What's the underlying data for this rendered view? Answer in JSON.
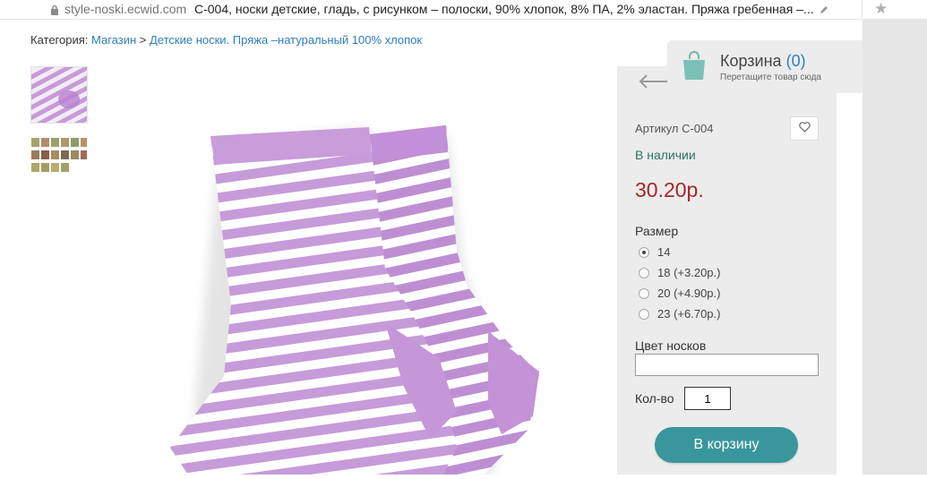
{
  "browser": {
    "domain": "style-noski.ecwid.com",
    "tab_title": "С-004, носки детские, гладь, с рисунком – полоски, 90% хлопок, 8% ПА, 2% эластан. Пряжа гребенная –...",
    "icons": [
      "lock-icon",
      "pencil-icon",
      "star-icon"
    ]
  },
  "breadcrumb": {
    "prefix": "Категория:",
    "items": [
      "Магазин",
      "Детские носки. Пряжа –натуральный 100% хлопок"
    ],
    "separator": " > "
  },
  "cart": {
    "title": "Корзина",
    "count": "(0)",
    "hint": "Перетащите товар сюда"
  },
  "product": {
    "sku": "Артикул С-004",
    "stock": "В наличии",
    "price": "30.20р.",
    "size_label": "Размер",
    "sizes": [
      {
        "label": "14",
        "selected": true
      },
      {
        "label": "18 (+3.20р.)",
        "selected": false
      },
      {
        "label": "20 (+4.90р.)",
        "selected": false
      },
      {
        "label": "23 (+6.70р.)",
        "selected": false
      }
    ],
    "color_label": "Цвет носков",
    "color_value": "",
    "qty_label": "Кол-во",
    "qty_value": "1",
    "add_to_cart": "В корзину"
  },
  "colors": {
    "link": "#2d7ec1",
    "stock": "#2e7263",
    "price": "#a6262a",
    "button": "#3a969d",
    "sock_lilac": "#c497d8"
  }
}
